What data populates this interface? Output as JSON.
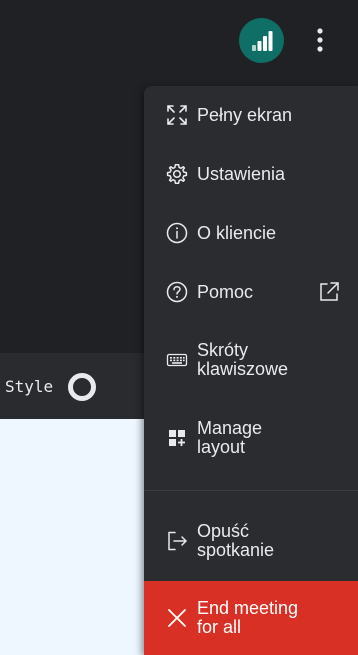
{
  "header": {
    "connection_icon": "signal-bars-icon",
    "more_icon": "more-vert-icon"
  },
  "toolbar": {
    "style_label": "Style"
  },
  "menu": {
    "items": [
      {
        "label": "Pełny ekran",
        "icon": "fullscreen-icon"
      },
      {
        "label": "Ustawienia",
        "icon": "gear-icon"
      },
      {
        "label": "O kliencie",
        "icon": "info-icon"
      },
      {
        "label": "Pomoc",
        "icon": "help-icon",
        "trailing_icon": "external-link-icon"
      },
      {
        "label": "Skróty\nklawiszowe",
        "icon": "keyboard-icon"
      },
      {
        "label": "Manage\nlayout",
        "icon": "layout-icon"
      },
      {
        "label": "Opuść\nspotkanie",
        "icon": "exit-icon"
      },
      {
        "label": "End meeting\nfor all",
        "icon": "close-icon"
      }
    ]
  },
  "colors": {
    "background": "#202124",
    "menu": "#2b2c30",
    "accent_teal": "#0f6e66",
    "danger": "#d93025",
    "canvas": "#eef6ff"
  }
}
